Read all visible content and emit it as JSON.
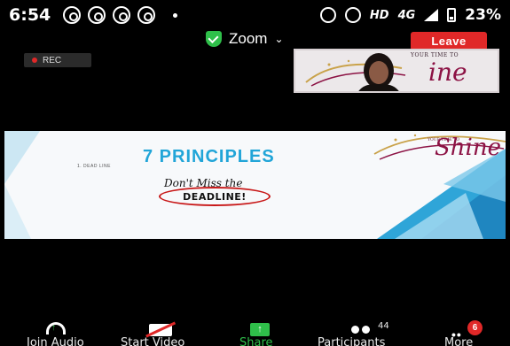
{
  "status_bar": {
    "time": "6:54",
    "network": "HD",
    "network_type": "4G",
    "battery": "23%"
  },
  "meeting": {
    "title": "Zoom",
    "leave_label": "Leave",
    "rec_label": "REC"
  },
  "thumbnail": {
    "slogan": "YOUR TIME TO",
    "script": "ine"
  },
  "slide": {
    "title": "7 PRINCIPLES",
    "subtitle": "1. DEAD LINE",
    "handwritten_line1": "Don't Miss the",
    "handwritten_line2": "DEADLINE!",
    "logo_slogan": "YOUR TIME TO",
    "logo_script": "Shine"
  },
  "toolbar": {
    "join_audio": "Join Audio",
    "start_video": "Start Video",
    "share": "Share",
    "participants": "Participants",
    "participants_count": "44",
    "more": "More",
    "more_badge": "6"
  },
  "colors": {
    "accent_green": "#2fbf4a",
    "leave_red": "#e02828",
    "slide_title_blue": "#21a5d8",
    "brand_magenta": "#8c1244"
  }
}
